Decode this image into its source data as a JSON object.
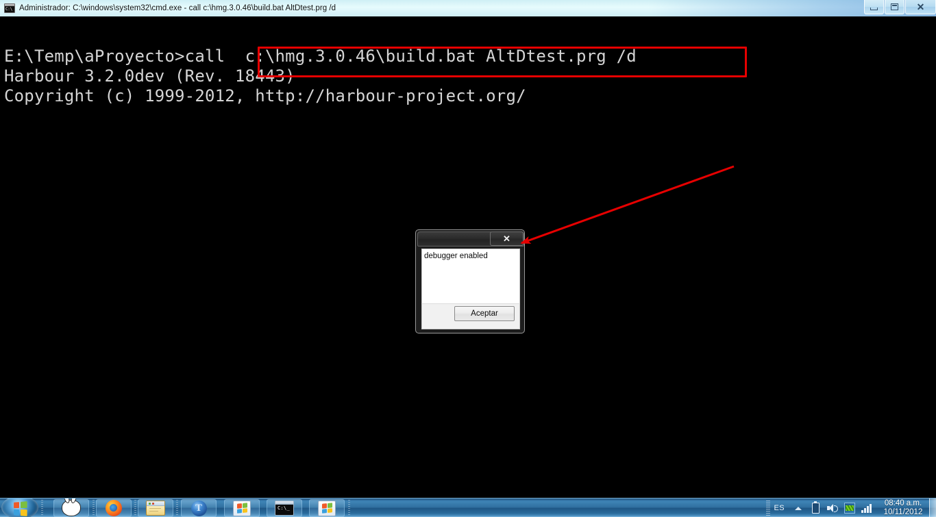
{
  "window": {
    "title": "Administrador: C:\\windows\\system32\\cmd.exe - call  c:\\hmg.3.0.46\\build.bat AltDtest.prg /d",
    "icon": "cmd-icon",
    "controls": {
      "minimize": "minimize-icon",
      "maximize": "maximize-icon",
      "close": "✕"
    }
  },
  "console": {
    "lines": [
      "E:\\Temp\\aProyecto>call  c:\\hmg.3.0.46\\build.bat AltDtest.prg /d",
      "Harbour 3.2.0dev (Rev. 18443)",
      "Copyright (c) 1999-2012, http://harbour-project.org/"
    ],
    "text": "E:\\Temp\\aProyecto>call  c:\\hmg.3.0.46\\build.bat AltDtest.prg /d\nHarbour 3.2.0dev (Rev. 18443)\nCopyright (c) 1999-2012, http://harbour-project.org/",
    "background": "#000000",
    "foreground": "#d5d5d5"
  },
  "annotations": {
    "color": "#e60000",
    "highlight_box_label": "command-highlight-box",
    "arrow_label": "callout-arrow"
  },
  "dialog": {
    "title": "",
    "close_label": "✕",
    "message": "debugger enabled",
    "accept_label": "Aceptar"
  },
  "taskbar": {
    "start_label": "Start",
    "items": [
      {
        "name": "taskbar-item-bunny",
        "icon": "bunny-icon",
        "label": ""
      },
      {
        "name": "taskbar-item-firefox",
        "icon": "firefox-icon",
        "label": ""
      },
      {
        "name": "taskbar-item-explorer",
        "icon": "folder-icon",
        "label": ""
      },
      {
        "name": "taskbar-item-t-app",
        "icon": "t-circle-icon",
        "label": "T"
      },
      {
        "name": "taskbar-item-windows-app-1",
        "icon": "windows-flag-icon",
        "label": ""
      },
      {
        "name": "taskbar-item-cmd",
        "icon": "cmd-icon",
        "label": ""
      },
      {
        "name": "taskbar-item-windows-app-2",
        "icon": "windows-flag-icon",
        "label": ""
      }
    ],
    "tray": {
      "language": "ES",
      "icons": [
        "chevron-up-icon",
        "battery-icon",
        "volume-icon",
        "network-activity-icon",
        "signal-bars-icon"
      ],
      "clock": "08:40 a.m.",
      "date": "10/11/2012"
    }
  }
}
